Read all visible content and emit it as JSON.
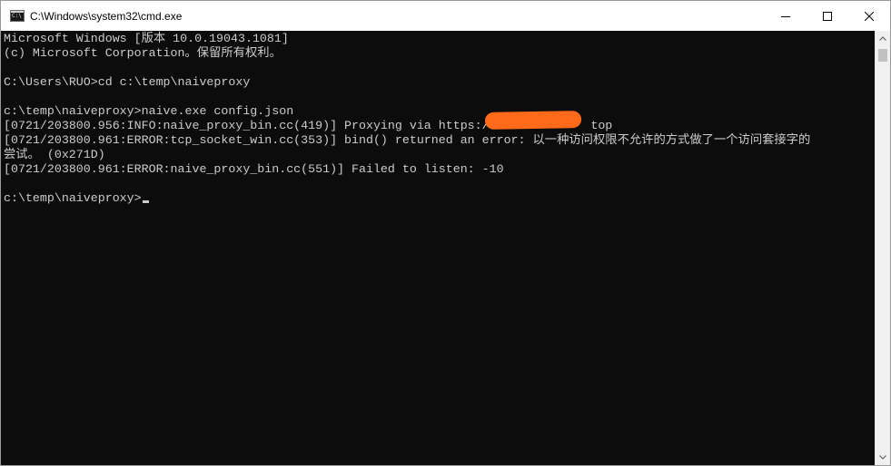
{
  "window": {
    "title": "C:\\Windows\\system32\\cmd.exe",
    "icon": "cmd-icon",
    "controls": {
      "minimize_icon": "minimize-icon",
      "maximize_icon": "maximize-icon",
      "close_icon": "close-icon"
    }
  },
  "console": {
    "lines": [
      "Microsoft Windows [版本 10.0.19043.1081]",
      "(c) Microsoft Corporation。保留所有权利。",
      "",
      "C:\\Users\\RUO>cd c:\\temp\\naiveproxy",
      "",
      "c:\\temp\\naiveproxy>naive.exe config.json",
      "[0721/203800.956:INFO:naive_proxy_bin.cc(419)] Proxying via https:/              top",
      "[0721/203800.961:ERROR:tcp_socket_win.cc(353)] bind() returned an error: 以一种访问权限不允许的方式做了一个访问套接字的",
      "尝试。 (0x271D)",
      "[0721/203800.961:ERROR:naive_proxy_bin.cc(551)] Failed to listen: -10",
      "",
      "c:\\temp\\naiveproxy>"
    ],
    "redaction_color": "#ff6a1a"
  },
  "colors": {
    "console_background": "#0c0c0c",
    "console_text": "#cccccc",
    "titlebar_background": "#ffffff",
    "scrollbar_track": "#f0f0f0",
    "scrollbar_thumb": "#c1c1c1"
  },
  "scrollbar": {
    "up_icon": "scroll-up-icon",
    "down_icon": "scroll-down-icon",
    "position_fraction": 0
  }
}
